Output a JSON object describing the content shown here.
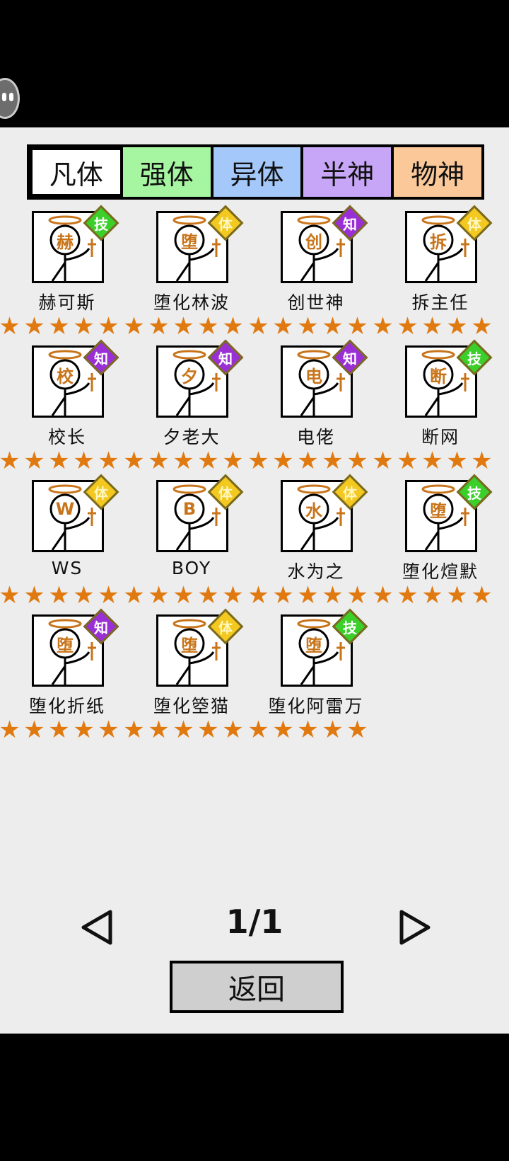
{
  "tabs": [
    {
      "label": "凡体",
      "color": "#ffffff"
    },
    {
      "label": "强体",
      "color": "#a6f5a0"
    },
    {
      "label": "异体",
      "color": "#a3c8f9"
    },
    {
      "label": "半神",
      "color": "#c8a6f7"
    },
    {
      "label": "物神",
      "color": "#fbc899"
    }
  ],
  "characters": [
    {
      "name": "赫可斯",
      "face": "赫",
      "badge": "技",
      "badge_color": "#3bcf2a",
      "stars": 5
    },
    {
      "name": "堕化林波",
      "face": "堕",
      "badge": "体",
      "badge_color": "#f3c81f",
      "stars": 5
    },
    {
      "name": "创世神",
      "face": "创",
      "badge": "知",
      "badge_color": "#9b2fd6",
      "stars": 5
    },
    {
      "name": "拆主任",
      "face": "拆",
      "badge": "体",
      "badge_color": "#f3c81f",
      "stars": 5
    },
    {
      "name": "校长",
      "face": "校",
      "badge": "知",
      "badge_color": "#9b2fd6",
      "stars": 5
    },
    {
      "name": "夕老大",
      "face": "夕",
      "badge": "知",
      "badge_color": "#9b2fd6",
      "stars": 5
    },
    {
      "name": "电佬",
      "face": "电",
      "badge": "知",
      "badge_color": "#9b2fd6",
      "stars": 5
    },
    {
      "name": "断网",
      "face": "断",
      "badge": "技",
      "badge_color": "#3bcf2a",
      "stars": 5
    },
    {
      "name": "WS",
      "face": "W",
      "badge": "体",
      "badge_color": "#f3c81f",
      "stars": 5
    },
    {
      "name": "BOY",
      "face": "B",
      "badge": "体",
      "badge_color": "#f3c81f",
      "stars": 5
    },
    {
      "name": "水为之",
      "face": "水",
      "badge": "体",
      "badge_color": "#f3c81f",
      "stars": 5
    },
    {
      "name": "堕化煊默",
      "face": "堕",
      "badge": "技",
      "badge_color": "#3bcf2a",
      "stars": 5
    },
    {
      "name": "堕化折纸",
      "face": "堕",
      "badge": "知",
      "badge_color": "#9b2fd6",
      "stars": 5
    },
    {
      "name": "堕化箜猫",
      "face": "堕",
      "badge": "体",
      "badge_color": "#f3c81f",
      "stars": 5
    },
    {
      "name": "堕化阿雷万",
      "face": "堕",
      "badge": "技",
      "badge_color": "#3bcf2a",
      "stars": 5
    }
  ],
  "pager": {
    "page": "1/1",
    "prev_icon": "triangle-left-icon",
    "next_icon": "triangle-right-icon"
  },
  "back_label": "返回",
  "star_color": "#e07a10",
  "face_color": "#c8741a"
}
